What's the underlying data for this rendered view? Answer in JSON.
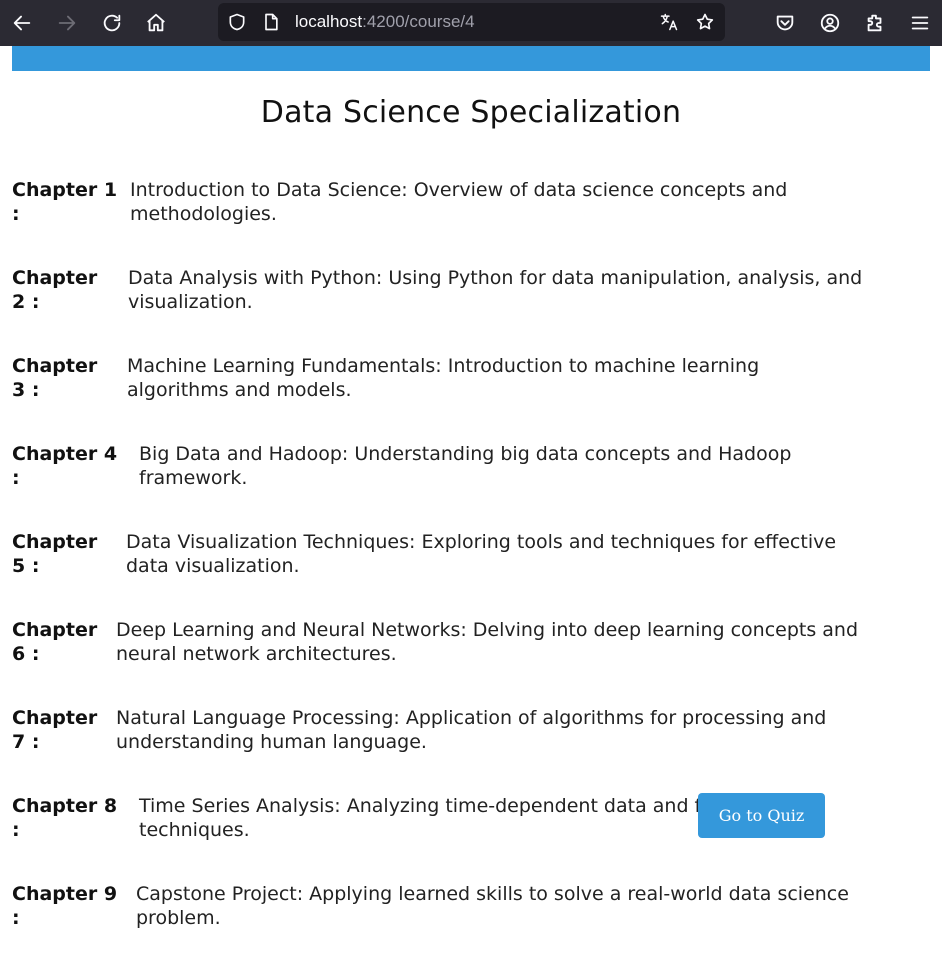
{
  "browser": {
    "url_host": "localhost",
    "url_path": ":4200/course/4",
    "icons": [
      "back-arrow-icon",
      "forward-arrow-icon",
      "reload-icon",
      "home-icon",
      "shield-icon",
      "page-icon",
      "translate-icon",
      "star-icon",
      "pocket-icon",
      "account-icon",
      "extensions-icon",
      "menu-icon"
    ]
  },
  "colors": {
    "accent": "#3498db",
    "toolbar": "#2b2a33",
    "urlbar": "#1c1b22"
  },
  "page": {
    "title": "Data Science Specialization",
    "quiz_button": "Go to Quiz"
  },
  "chapters": [
    {
      "label": "Chapter 1\n:",
      "description": "Introduction to Data Science: Overview of data science concepts and\nmethodologies."
    },
    {
      "label": "Chapter\n2 :",
      "description": "Data Analysis with Python: Using Python for data manipulation, analysis, and\nvisualization."
    },
    {
      "label": "Chapter\n3 :",
      "description": "Machine Learning Fundamentals: Introduction to machine learning\nalgorithms and models."
    },
    {
      "label": "Chapter 4\n:",
      "description": "Big Data and Hadoop: Understanding big data concepts and Hadoop\nframework."
    },
    {
      "label": "Chapter\n5 :",
      "description": "Data Visualization Techniques: Exploring tools and techniques for effective\ndata visualization."
    },
    {
      "label": "Chapter\n6 :",
      "description": "Deep Learning and Neural Networks: Delving into deep learning concepts and\nneural network architectures."
    },
    {
      "label": "Chapter\n7 :",
      "description": "Natural Language Processing: Application of algorithms for processing and\nunderstanding human language."
    },
    {
      "label": "Chapter 8\n:",
      "description": "Time Series Analysis: Analyzing time-dependent data and forecasting\ntechniques."
    },
    {
      "label": "Chapter 9\n:",
      "description": "Capstone Project: Applying learned skills to solve a real-world data science\nproblem."
    }
  ]
}
